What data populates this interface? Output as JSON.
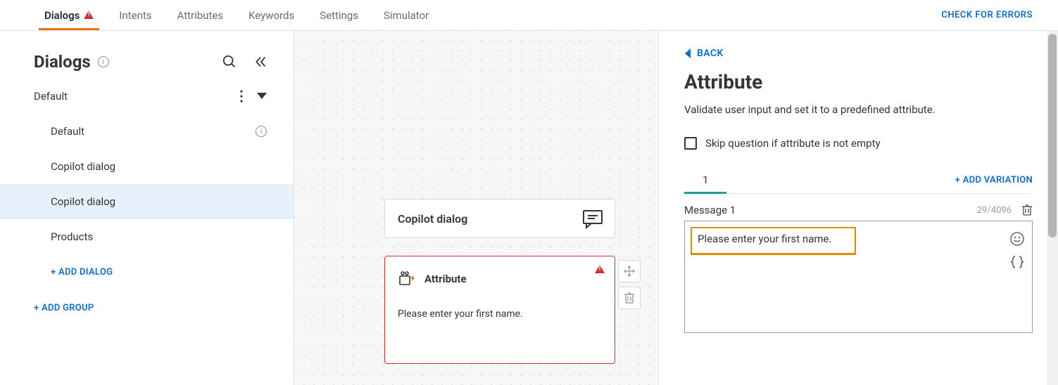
{
  "nav": {
    "tabs": [
      {
        "label": "Dialogs",
        "warn": true
      },
      {
        "label": "Intents"
      },
      {
        "label": "Attributes"
      },
      {
        "label": "Keywords"
      },
      {
        "label": "Settings"
      },
      {
        "label": "Simulator"
      }
    ],
    "check_errors": "CHECK FOR ERRORS"
  },
  "sidebar": {
    "title": "Dialogs",
    "groups": [
      {
        "name": "Default",
        "dialogs": [
          {
            "name": "Default",
            "info": true
          },
          {
            "name": "Copilot dialog"
          },
          {
            "name": "Copilot dialog",
            "selected": true
          },
          {
            "name": "Products"
          }
        ]
      }
    ],
    "add_dialog": "+ ADD DIALOG",
    "add_group": "+ ADD GROUP"
  },
  "canvas": {
    "dialog_title": "Copilot dialog",
    "attr_node": {
      "title": "Attribute",
      "body": "Please enter your first name."
    }
  },
  "panel": {
    "back": "BACK",
    "heading": "Attribute",
    "desc": "Validate user input and set it to a predefined attribute.",
    "skip_label": "Skip question if attribute is not empty",
    "variations": {
      "tabs": [
        "1"
      ],
      "add": "+ ADD VARIATION"
    },
    "message": {
      "label": "Message 1",
      "counter": "29/4096",
      "text": "Please enter your first name."
    }
  }
}
